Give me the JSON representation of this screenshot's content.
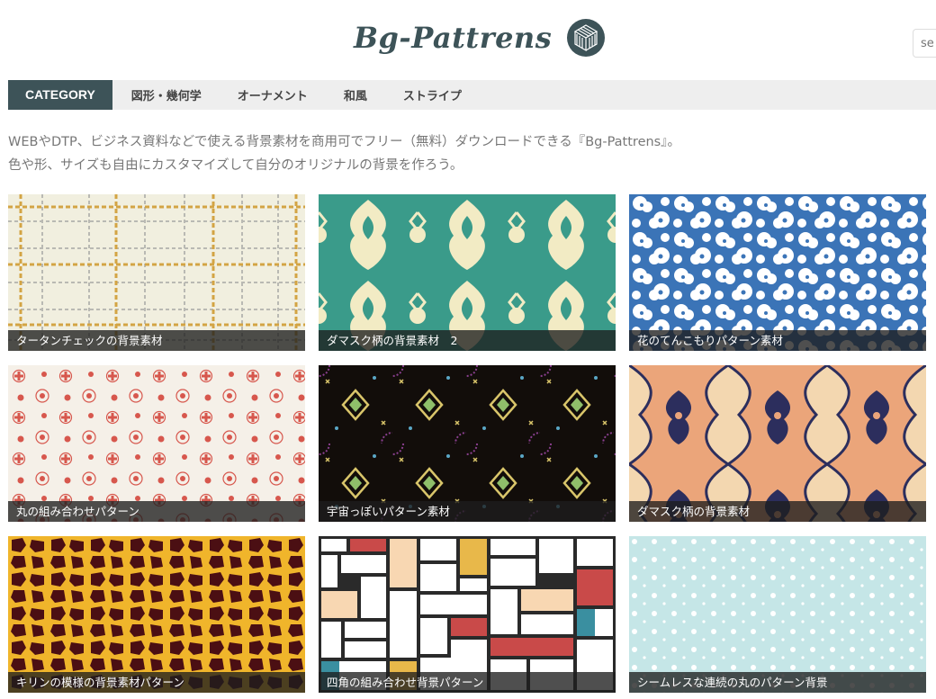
{
  "site": {
    "title": "Bg-Pattrens",
    "search_placeholder": "se"
  },
  "nav": {
    "category_label": "CATEGORY",
    "items": [
      "図形・幾何学",
      "オーナメント",
      "和風",
      "ストライプ"
    ]
  },
  "intro": {
    "line1": "WEBやDTP、ビジネス資料などで使える背景素材を商用可でフリー（無料）ダウンロードできる『Bg-Pattrens』。",
    "line2": "色や形、サイズも自由にカスタマイズして自分のオリジナルの背景を作ろう。"
  },
  "cards": [
    {
      "caption": "タータンチェックの背景素材",
      "colors": {
        "bg": "#f1efdf",
        "line": "#d3a444"
      }
    },
    {
      "caption": "ダマスク柄の背景素材　2",
      "colors": {
        "bg": "#3a9b8a",
        "fg": "#f2ebc4"
      }
    },
    {
      "caption": "花のてんこもりパターン素材",
      "colors": {
        "bg": "#3b74b7",
        "fg": "#ffffff"
      }
    },
    {
      "caption": "丸の組み合わせパターン",
      "colors": {
        "bg": "#f5f0e8",
        "fg": "#d7574d"
      }
    },
    {
      "caption": "宇宙っぽいパターン素材",
      "colors": {
        "bg": "#120d0a",
        "fg": "#d9c56a"
      }
    },
    {
      "caption": "ダマスク柄の背景素材",
      "colors": {
        "bg": "#eba57a",
        "fg": "#2c2e5d"
      }
    },
    {
      "caption": "キリンの模様の背景素材パターン",
      "colors": {
        "bg": "#f0b52b",
        "fg": "#4b0f13"
      }
    },
    {
      "caption": "四角の組み合わせ背景パターン",
      "colors": {
        "bg": "#ffffff",
        "fg": "#c94a49"
      }
    },
    {
      "caption": "シームレスな連続の丸のパターン背景",
      "colors": {
        "bg": "#c5e6e7",
        "fg": "#ffffff"
      }
    }
  ]
}
